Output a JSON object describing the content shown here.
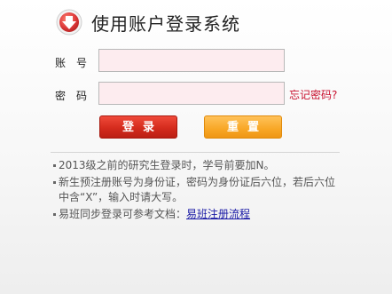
{
  "header": {
    "title": "使用账户登录系统",
    "icon": "download-arrow-icon",
    "icon_color": "#e03c3c"
  },
  "form": {
    "account_label": "账号",
    "account_value": "",
    "password_label": "密码",
    "password_value": "",
    "forgot_link": "忘记密码?",
    "login_button": "登录",
    "reset_button": "重置"
  },
  "notes": {
    "items": [
      "2013级之前的研究生登录时，学号前要加N。",
      "新生预注册账号为身份证，密码为身份证后六位，若后六位中含“X”，输入时请大写。"
    ],
    "last_prefix": "易班同步登录可参考文档：",
    "last_link": "易班注册流程"
  },
  "colors": {
    "input_bg": "#fdecef",
    "login_button": "#d42b1d",
    "reset_button": "#f8a726",
    "forgot_link": "#c8102e",
    "doc_link": "#1a1aa6"
  }
}
